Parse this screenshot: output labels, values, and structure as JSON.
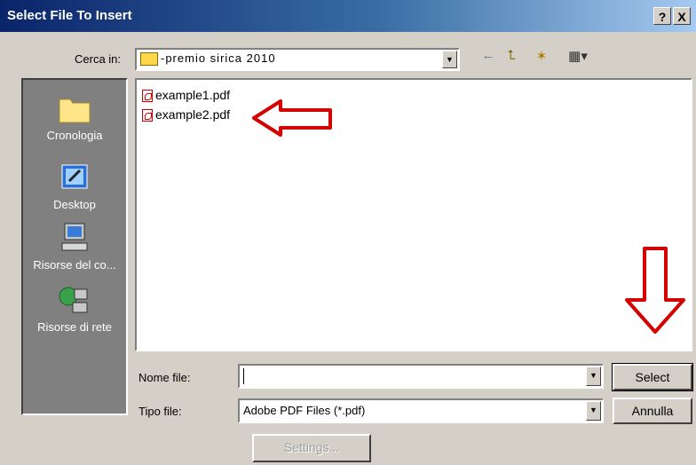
{
  "window": {
    "title": "Select File To Insert",
    "help": "?",
    "close": "X"
  },
  "lookin": {
    "label": "Cerca in:",
    "value": "-premio sirica 2010"
  },
  "toolbar": {
    "back": "←",
    "up": "⮤",
    "newfolder": "✶",
    "view": "▦▾"
  },
  "places": [
    {
      "label": "Cronologia"
    },
    {
      "label": "Desktop"
    },
    {
      "label": "Risorse del co..."
    },
    {
      "label": "Risorse di rete"
    }
  ],
  "files": [
    {
      "name": "example1.pdf"
    },
    {
      "name": "example2.pdf"
    }
  ],
  "filename": {
    "label": "Nome file:",
    "value": ""
  },
  "filetype": {
    "label": "Tipo file:",
    "value": "Adobe PDF Files (*.pdf)"
  },
  "buttons": {
    "select": "Select",
    "cancel": "Annulla",
    "settings": "Settings..."
  },
  "colors": {
    "annotation_arrow": "#d40000",
    "title_start": "#0a246a",
    "title_end": "#a6caf0"
  }
}
